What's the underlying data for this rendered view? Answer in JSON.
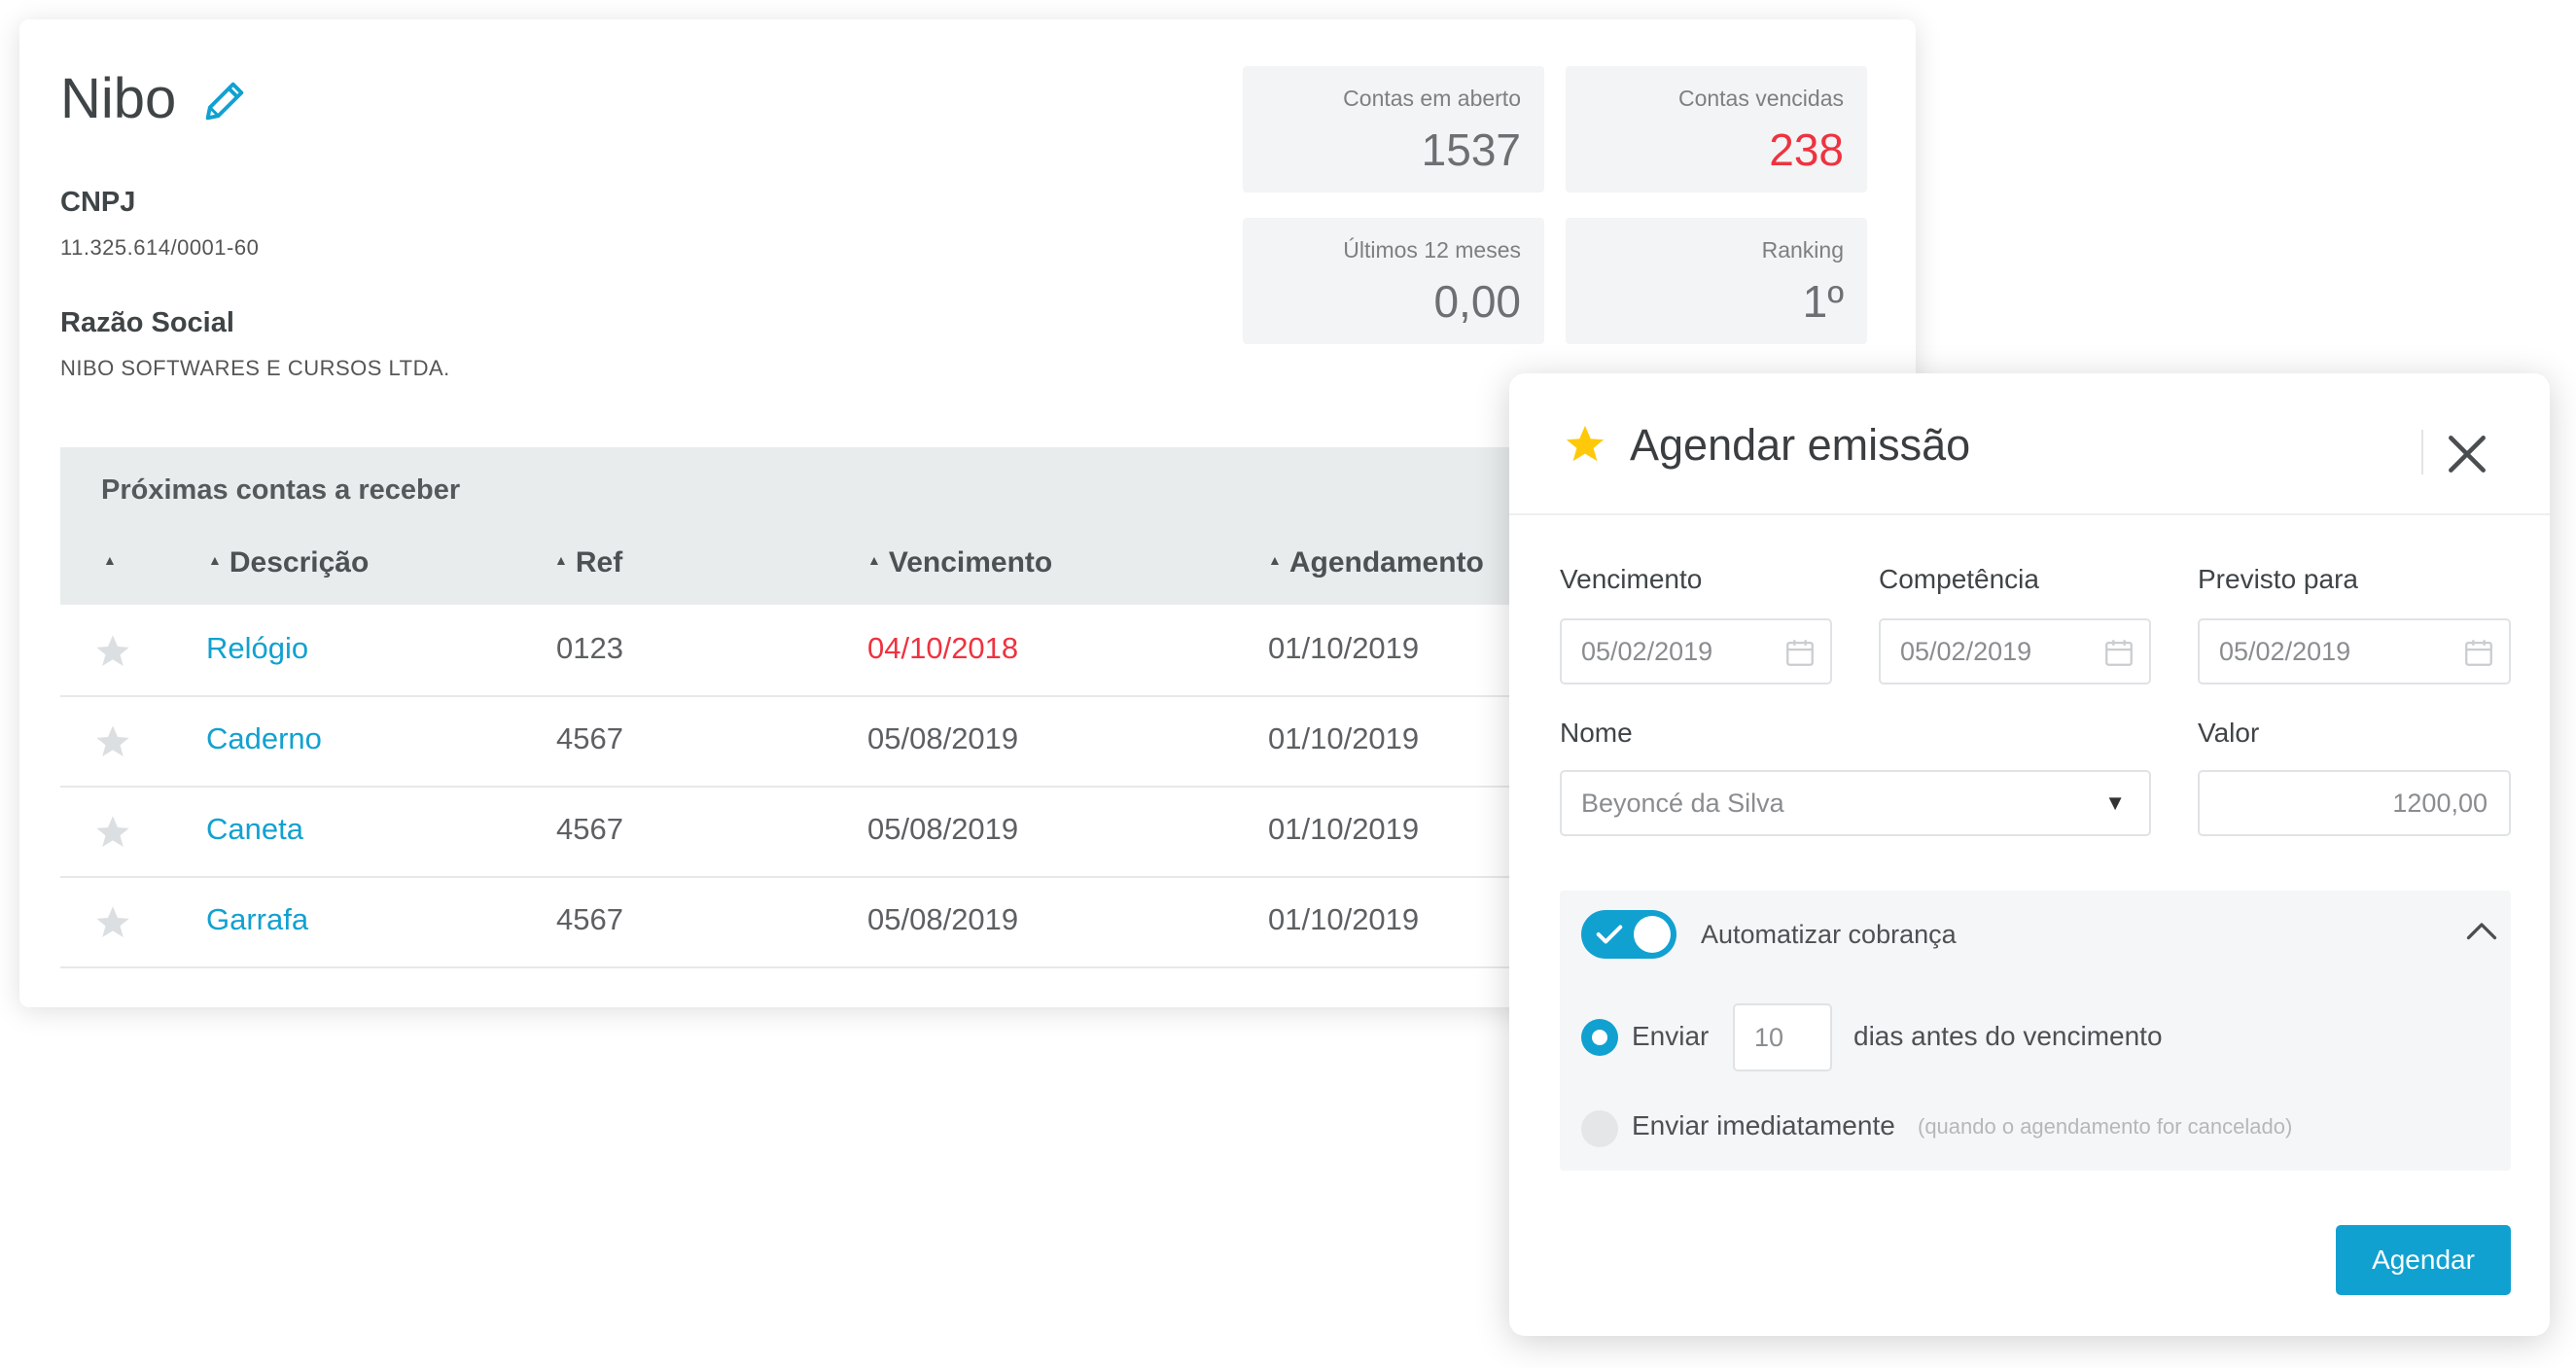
{
  "company": {
    "name": "Nibo",
    "cnpj_label": "CNPJ",
    "cnpj_value": "11.325.614/0001-60",
    "razao_label": "Razão Social",
    "razao_value": "NIBO SOFTWARES E CURSOS LTDA."
  },
  "stats": [
    {
      "label": "Contas em aberto",
      "value": "1537"
    },
    {
      "label": "Contas vencidas",
      "value": "238"
    },
    {
      "label": "Últimos 12 meses",
      "value": "0,00"
    },
    {
      "label": "Ranking",
      "value": "1º"
    }
  ],
  "table": {
    "title": "Próximas contas a receber",
    "columns": [
      "",
      "Descrição",
      "Ref",
      "Vencimento",
      "Agendamento"
    ],
    "rows": [
      {
        "descricao": "Relógio",
        "ref": "0123",
        "vencimento": "04/10/2018",
        "agendamento": "01/10/2019",
        "overdue": true
      },
      {
        "descricao": "Caderno",
        "ref": "4567",
        "vencimento": "05/08/2019",
        "agendamento": "01/10/2019",
        "overdue": false
      },
      {
        "descricao": "Caneta",
        "ref": "4567",
        "vencimento": "05/08/2019",
        "agendamento": "01/10/2019",
        "overdue": false
      },
      {
        "descricao": "Garrafa",
        "ref": "4567",
        "vencimento": "05/08/2019",
        "agendamento": "01/10/2019",
        "overdue": false
      }
    ]
  },
  "modal": {
    "title": "Agendar emissão",
    "fields": {
      "vencimento": {
        "label": "Vencimento",
        "value": "05/02/2019"
      },
      "competencia": {
        "label": "Competência",
        "value": "05/02/2019"
      },
      "previsto": {
        "label": "Previsto para",
        "value": "05/02/2019"
      },
      "nome": {
        "label": "Nome",
        "value": "Beyoncé da Silva"
      },
      "valor": {
        "label": "Valor",
        "value": "1200,00"
      }
    },
    "automation": {
      "label": "Automatizar cobrança",
      "enabled": true,
      "option_send_label": "Enviar",
      "days_value": "10",
      "days_suffix": "dias antes do vencimento",
      "option_immediate_label": "Enviar imediatamente",
      "immediate_hint": "(quando o agendamento for cancelado)"
    },
    "submit_label": "Agendar"
  },
  "icons": [
    "pencil-icon",
    "star-icon",
    "close-icon",
    "calendar-icon",
    "chevron-up-icon",
    "check-icon",
    "dropdown-arrow-icon"
  ],
  "colors": {
    "accent": "#11a1d1",
    "danger": "#ee3340",
    "star": "#ffc90b",
    "star_inactive": "#dcdfe1"
  }
}
